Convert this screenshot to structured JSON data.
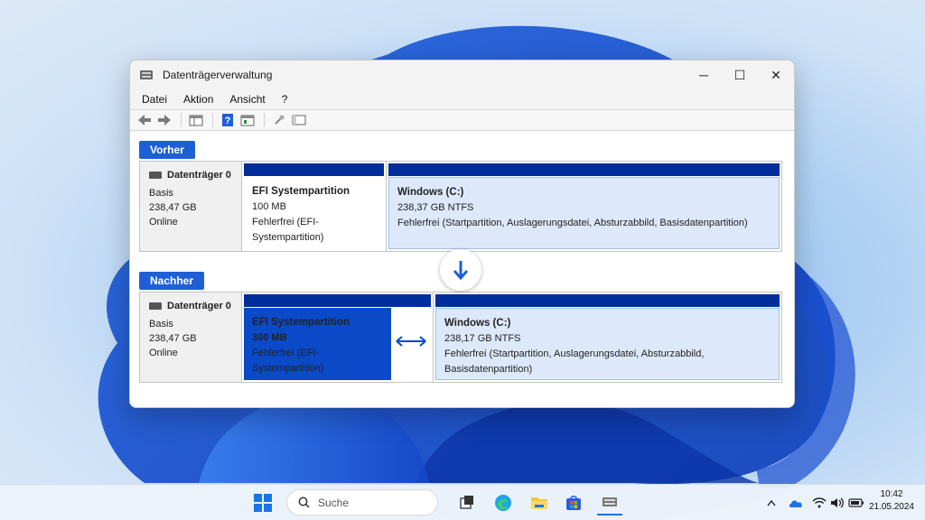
{
  "window": {
    "title": "Datenträgerverwaltung",
    "controls": {
      "minimize": "─",
      "maximize": "☐",
      "close": "✕"
    }
  },
  "menu": [
    "Datei",
    "Aktion",
    "Ansicht",
    "?"
  ],
  "toolbar_icons": [
    "back-arrow-icon",
    "forward-arrow-icon",
    "disk-list-icon",
    "help-icon",
    "properties-icon",
    "rescan-icon",
    "console-icon"
  ],
  "before": {
    "tag": "Vorher",
    "disk": {
      "name": "Datenträger 0",
      "type": "Basis",
      "size": "238,47 GB",
      "status": "Online"
    },
    "efi": {
      "name": "EFI Systempartition",
      "size": "100 MB",
      "status": "Fehlerfrei (EFI-Systempartition)"
    },
    "windows": {
      "name": "Windows  (C:)",
      "size": "238,37 GB NTFS",
      "status": "Fehlerfrei (Startpartition, Auslagerungsdatei, Absturzabbild, Basisdatenpartition)"
    }
  },
  "after": {
    "tag": "Nachher",
    "disk": {
      "name": "Datenträger 0",
      "type": "Basis",
      "size": "238,47 GB",
      "status": "Online"
    },
    "efi": {
      "name": "EFI Systempartition",
      "size": "300 MB",
      "status": "Fehlerfrei (EFI-Systempartition)"
    },
    "windows": {
      "name": "Windows  (C:)",
      "size": "238,17 GB NTFS",
      "status": "Fehlerfrei (Startpartition, Auslagerungsdatei, Absturzabbild, Basisdatenpartition)"
    }
  },
  "taskbar": {
    "search_placeholder": "Suche",
    "apps": [
      "windows-start-icon",
      "search-icon",
      "task-view-icon",
      "edge-icon",
      "file-explorer-icon",
      "store-icon",
      "disk-management-icon"
    ],
    "tray": [
      "chevron-up-icon",
      "onedrive-icon",
      "wifi-icon",
      "volume-icon",
      "battery-icon"
    ],
    "time": "10:42",
    "date": "21.05.2024"
  },
  "colors": {
    "accent": "#1e5fd8",
    "partition_bar": "#002d9c",
    "selected_partition": "#0a49c8"
  }
}
